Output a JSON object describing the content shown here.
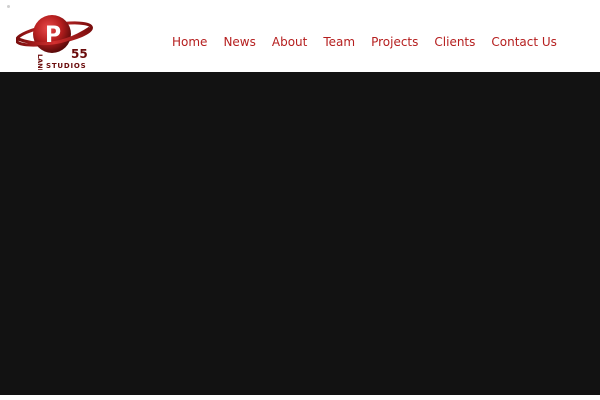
{
  "brand": {
    "logo_alt": "Planet 55 Studios",
    "logo_letter": "P",
    "logo_word_planet": "LANET",
    "logo_number": "55",
    "logo_word_studios": "STUDIOS",
    "accent_color": "#b51e1e"
  },
  "nav": {
    "items": [
      {
        "label": "Home"
      },
      {
        "label": "News"
      },
      {
        "label": "About"
      },
      {
        "label": "Team"
      },
      {
        "label": "Projects"
      },
      {
        "label": "Clients"
      },
      {
        "label": "Contact Us"
      }
    ]
  },
  "hero": {
    "background_color": "#121212"
  }
}
